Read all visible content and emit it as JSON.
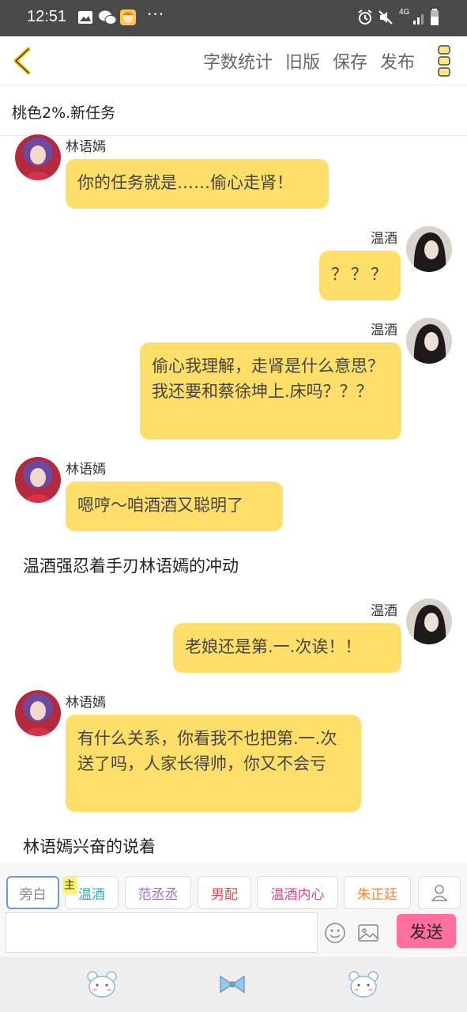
{
  "status_bar": {
    "time": "12:51",
    "dots": "···",
    "network": "4G"
  },
  "toolbar": {
    "actions": [
      "字数统计",
      "旧版",
      "保存",
      "发布"
    ]
  },
  "story_title": "桃色2%.新任务",
  "messages": [
    {
      "name": "林语嫣",
      "text": "你的任务就是……偷心走肾！"
    },
    {
      "name": "温酒",
      "text": "？？？"
    },
    {
      "name": "温酒",
      "text": "偷心我理解，走肾是什么意思？我还要和蔡徐坤上.床吗？？？"
    },
    {
      "name": "林语嫣",
      "text": "嗯哼～咱酒酒又聪明了"
    },
    {
      "narration": "温酒强忍着手刃林语嫣的冲动"
    },
    {
      "name": "温酒",
      "text": "老娘还是第.一.次诶！！"
    },
    {
      "name": "林语嫣",
      "text": "有什么关系，你看我不也把第.一.次送了吗，人家长得帅，你又不会亏"
    },
    {
      "narration": "林语嫣兴奋的说着"
    }
  ],
  "roles": {
    "main_tag": "主",
    "items": [
      {
        "label": "旁白",
        "color": "#8a8a8a"
      },
      {
        "label": "温酒",
        "color": "#2ab0b0"
      },
      {
        "label": "范丞丞",
        "color": "#a86cc1"
      },
      {
        "label": "男配",
        "color": "#e04b4b"
      },
      {
        "label": "温酒内心",
        "color": "#e0448c"
      },
      {
        "label": "朱正廷",
        "color": "#f0883a"
      }
    ]
  },
  "input": {
    "placeholder": "",
    "send_label": "发送"
  },
  "colors": {
    "bubble": "#ffde6a",
    "accent": "#f5c400",
    "send": "#ff6fa0"
  }
}
